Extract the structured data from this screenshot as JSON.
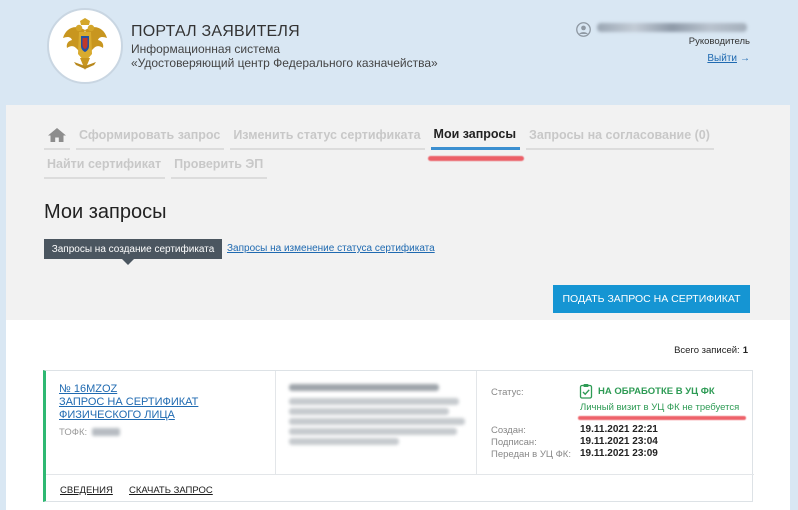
{
  "header": {
    "title": "ПОРТАЛ ЗАЯВИТЕЛЯ",
    "subtitle_line1": "Информационная система",
    "subtitle_line2": "«Удостоверяющий центр Федерального казначейства»"
  },
  "user": {
    "role": "Руководитель",
    "logout": "Выйти",
    "logout_arrow": "→"
  },
  "nav": {
    "row1": [
      {
        "label": "Сформировать запрос",
        "active": false
      },
      {
        "label": "Изменить статус сертификата",
        "active": false
      },
      {
        "label": "Мои запросы",
        "active": true
      },
      {
        "label": "Запросы на согласование (0)",
        "active": false
      }
    ],
    "row2": [
      {
        "label": "Найти сертификат",
        "active": false
      },
      {
        "label": "Проверить ЭП",
        "active": false
      }
    ]
  },
  "page": {
    "title": "Мои запросы",
    "subtab_active": "Запросы на создание сертификата",
    "subtab_other": "Запросы на изменение статуса сертификата",
    "submit_button": "ПОДАТЬ ЗАПРОС НА СЕРТИФИКАТ",
    "total_label": "Всего записей:",
    "total_value": "1"
  },
  "request": {
    "number": "№ 16MZOZ",
    "title": "ЗАПРОС НА СЕРТИФИКАТ ФИЗИЧЕСКОГО ЛИЦА",
    "tofk_label": "ТОФК:",
    "tofk_value": "2",
    "status_label": "Статус:",
    "status_value": "НА ОБРАБОТКЕ В УЦ ФК",
    "status_note": "Личный визит в УЦ ФК не требуется",
    "created_label": "Создан:",
    "created_value": "19.11.2021 22:21",
    "signed_label": "Подписан:",
    "signed_value": "19.11.2021 23:04",
    "sent_label": "Передан в УЦ ФК:",
    "sent_value": "19.11.2021 23:09",
    "details_link": "СВЕДЕНИЯ",
    "download_link": "СКАЧАТЬ ЗАПРОС"
  },
  "colors": {
    "accent_blue": "#1595d3",
    "link_blue": "#1f6ab1",
    "status_green": "#2e9b55",
    "card_border_green": "#2eb872",
    "highlight_red": "#eb4650"
  }
}
